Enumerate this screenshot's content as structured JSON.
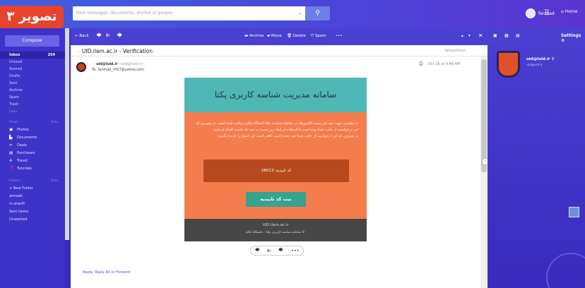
{
  "brand_tag": "تصویر ۳",
  "search": {
    "placeholder": "Find messages, documents, photos or people"
  },
  "header": {
    "user": "farshad",
    "home": "Home"
  },
  "sidebar": {
    "compose": "Compose",
    "folders_main": [
      {
        "label": "Inbox",
        "count": "254",
        "selected": true
      },
      {
        "label": "Unread"
      },
      {
        "label": "Starred"
      },
      {
        "label": "Drafts"
      },
      {
        "label": "Sent"
      },
      {
        "label": "Archive"
      },
      {
        "label": "Spam"
      },
      {
        "label": "Trash"
      },
      {
        "label": "Less"
      }
    ],
    "views_label": "Views",
    "views_hide": "Hide",
    "views": [
      {
        "label": "Photos",
        "icon": "photo-icon"
      },
      {
        "label": "Documents",
        "icon": "document-icon"
      },
      {
        "label": "Deals",
        "icon": "scissors-icon"
      },
      {
        "label": "Purchases",
        "icon": "receipt-icon"
      },
      {
        "label": "Travel",
        "icon": "plane-icon"
      },
      {
        "label": "Tutorials",
        "icon": "question-icon"
      }
    ],
    "folders_label": "Folders",
    "folders_hide": "Hide",
    "new_folder": "+ New Folder",
    "folders": [
      "ahmadi",
      "m.sharifi",
      "Sent Items",
      "Unwanted"
    ]
  },
  "toolbar": {
    "back": "Back",
    "archive": "Archive",
    "move": "Move",
    "delete": "Delete",
    "spam": "Spam",
    "more": "•••"
  },
  "message": {
    "subject": "UID.ilam.ac.ir - Verification",
    "folder_path": "Yahoo/Inbox",
    "from_name": "uid@luid.ir",
    "from_email": "<uid@luid.ir>",
    "to": "To: farshad_r007@yahoo.com",
    "date": "Oct 28 at 9:48 AM"
  },
  "email": {
    "title": "سامانه مدیریت شناسه کاربری یکتا",
    "body_line1": "درخواستی جهت ثبت این پست الکترونیک در سامانه شناسه یکتا دانشگاه ایلام دریافت شده است. در صورتی که این درخواست از جانب شما بوده است با استفاده از لینک زیر نسبت به ثبت کد تاییدیه اقدام فرمایید.",
    "body_line2": "در صورتی که این درخواست از جانب شما ثبت نشده است کافی است این ایمیل را نادیده بگیرید.",
    "code_label": "کد تاییدیه: 28013",
    "button": "ثبت کد تاییدیه",
    "footer_site": "UID.ilam.ac.ir",
    "footer_copy": "© سامانه شناسه کاربری یکتا - دانشگاه ایلام"
  },
  "reply_links": {
    "reply": "Reply",
    "reply_all": "Reply All",
    "or": "or",
    "forward": "Forward"
  },
  "right": {
    "settings": "Settings",
    "profile_name": "uid@luid.ir",
    "profile_sub": "uid@uid.ir"
  }
}
